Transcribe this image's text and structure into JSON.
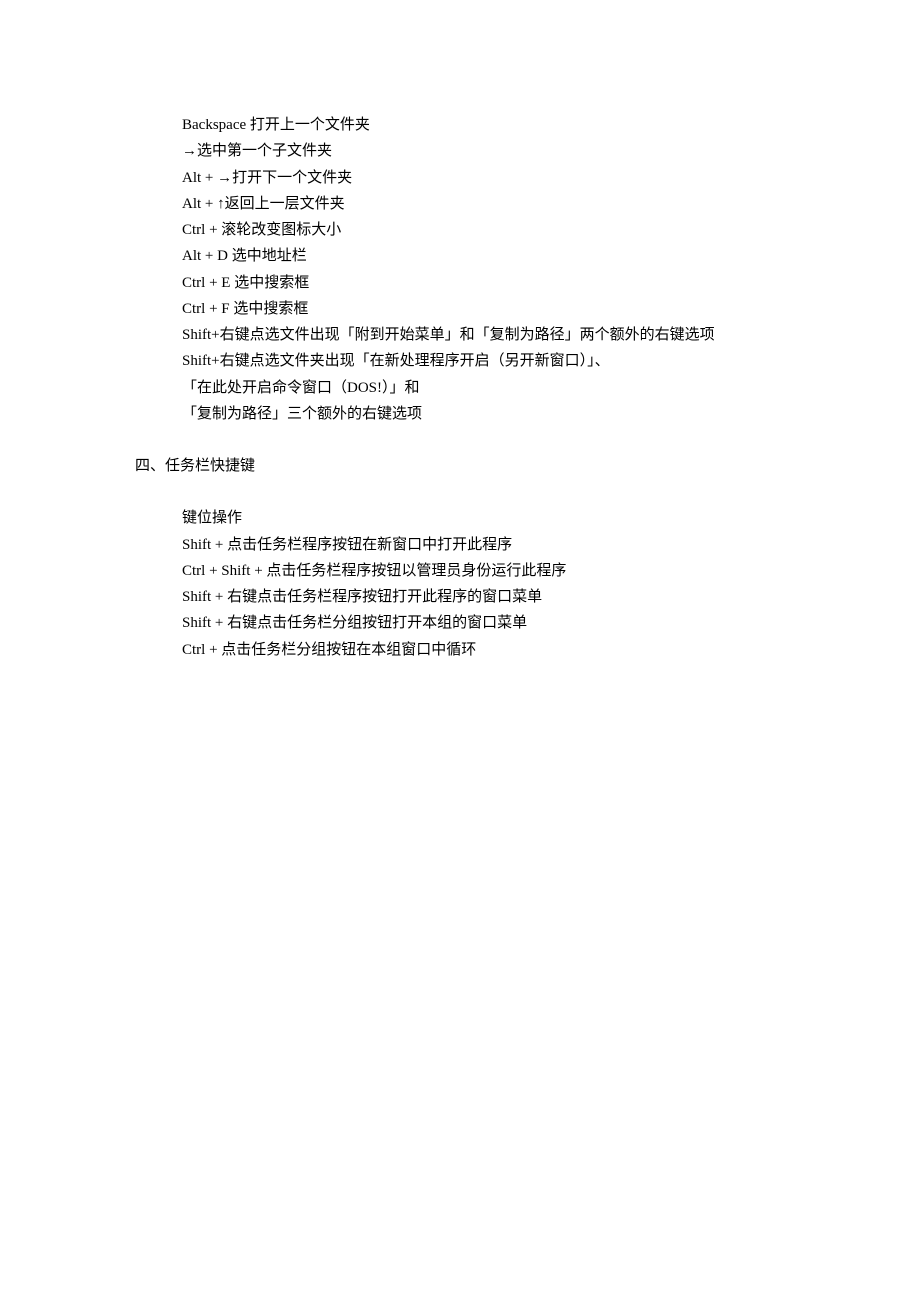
{
  "section1": {
    "lines": [
      "Backspace 打开上一个文件夹",
      "→选中第一个子文件夹",
      "Alt + →打开下一个文件夹",
      "Alt + ↑返回上一层文件夹",
      "Ctrl + 滚轮改变图标大小",
      "Alt + D 选中地址栏",
      "Ctrl + E 选中搜索框",
      "Ctrl + F 选中搜索框",
      "Shift+右键点选文件出现「附到开始菜单」和「复制为路径」两个额外的右键选项",
      "Shift+右键点选文件夹出现「在新处理程序开启（另开新窗口）」、",
      "「在此处开启命令窗口（DOS!）」和",
      "「复制为路径」三个额外的右键选项"
    ]
  },
  "section2": {
    "heading": "四、任务栏快捷键",
    "lines": [
      "键位操作",
      "Shift + 点击任务栏程序按钮在新窗口中打开此程序",
      "Ctrl + Shift + 点击任务栏程序按钮以管理员身份运行此程序",
      "Shift + 右键点击任务栏程序按钮打开此程序的窗口菜单",
      "Shift + 右键点击任务栏分组按钮打开本组的窗口菜单",
      "Ctrl + 点击任务栏分组按钮在本组窗口中循环"
    ]
  }
}
